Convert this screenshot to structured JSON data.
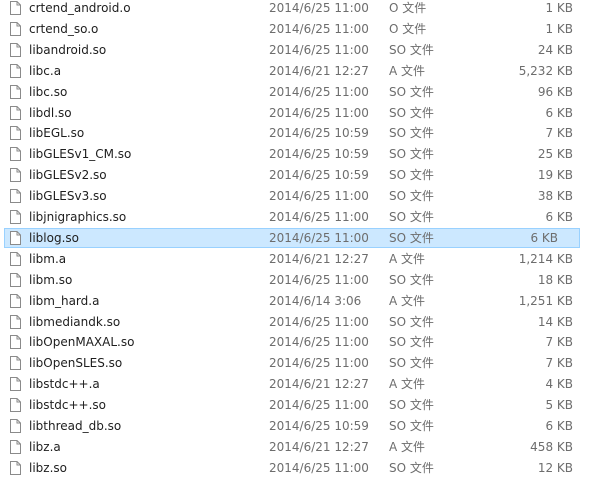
{
  "file_list": {
    "selected_index": 11,
    "icon": "blank-file-icon",
    "colors": {
      "selection_fill": "#cce8ff",
      "selection_border": "#99d1ff",
      "secondary_text": "#6d6d6d",
      "primary_text": "#1e1e1e"
    },
    "rows": [
      {
        "name": "crtend_android.o",
        "date": "2014/6/25 11:00",
        "type": "O 文件",
        "size": "1 KB"
      },
      {
        "name": "crtend_so.o",
        "date": "2014/6/25 11:00",
        "type": "O 文件",
        "size": "1 KB"
      },
      {
        "name": "libandroid.so",
        "date": "2014/6/25 11:00",
        "type": "SO 文件",
        "size": "24 KB"
      },
      {
        "name": "libc.a",
        "date": "2014/6/21 12:27",
        "type": "A 文件",
        "size": "5,232 KB"
      },
      {
        "name": "libc.so",
        "date": "2014/6/25 11:00",
        "type": "SO 文件",
        "size": "96 KB"
      },
      {
        "name": "libdl.so",
        "date": "2014/6/25 11:00",
        "type": "SO 文件",
        "size": "6 KB"
      },
      {
        "name": "libEGL.so",
        "date": "2014/6/25 10:59",
        "type": "SO 文件",
        "size": "7 KB"
      },
      {
        "name": "libGLESv1_CM.so",
        "date": "2014/6/25 10:59",
        "type": "SO 文件",
        "size": "25 KB"
      },
      {
        "name": "libGLESv2.so",
        "date": "2014/6/25 10:59",
        "type": "SO 文件",
        "size": "19 KB"
      },
      {
        "name": "libGLESv3.so",
        "date": "2014/6/25 11:00",
        "type": "SO 文件",
        "size": "38 KB"
      },
      {
        "name": "libjnigraphics.so",
        "date": "2014/6/25 11:00",
        "type": "SO 文件",
        "size": "6 KB"
      },
      {
        "name": "liblog.so",
        "date": "2014/6/25 11:00",
        "type": "SO 文件",
        "size": "6 KB"
      },
      {
        "name": "libm.a",
        "date": "2014/6/21 12:27",
        "type": "A 文件",
        "size": "1,214 KB"
      },
      {
        "name": "libm.so",
        "date": "2014/6/25 11:00",
        "type": "SO 文件",
        "size": "18 KB"
      },
      {
        "name": "libm_hard.a",
        "date": "2014/6/14 3:06",
        "type": "A 文件",
        "size": "1,251 KB"
      },
      {
        "name": "libmediandk.so",
        "date": "2014/6/25 11:00",
        "type": "SO 文件",
        "size": "14 KB"
      },
      {
        "name": "libOpenMAXAL.so",
        "date": "2014/6/25 11:00",
        "type": "SO 文件",
        "size": "7 KB"
      },
      {
        "name": "libOpenSLES.so",
        "date": "2014/6/25 11:00",
        "type": "SO 文件",
        "size": "7 KB"
      },
      {
        "name": "libstdc++.a",
        "date": "2014/6/21 12:27",
        "type": "A 文件",
        "size": "4 KB"
      },
      {
        "name": "libstdc++.so",
        "date": "2014/6/25 11:00",
        "type": "SO 文件",
        "size": "5 KB"
      },
      {
        "name": "libthread_db.so",
        "date": "2014/6/25 10:59",
        "type": "SO 文件",
        "size": "6 KB"
      },
      {
        "name": "libz.a",
        "date": "2014/6/21 12:27",
        "type": "A 文件",
        "size": "458 KB"
      },
      {
        "name": "libz.so",
        "date": "2014/6/25 11:00",
        "type": "SO 文件",
        "size": "12 KB"
      }
    ]
  }
}
